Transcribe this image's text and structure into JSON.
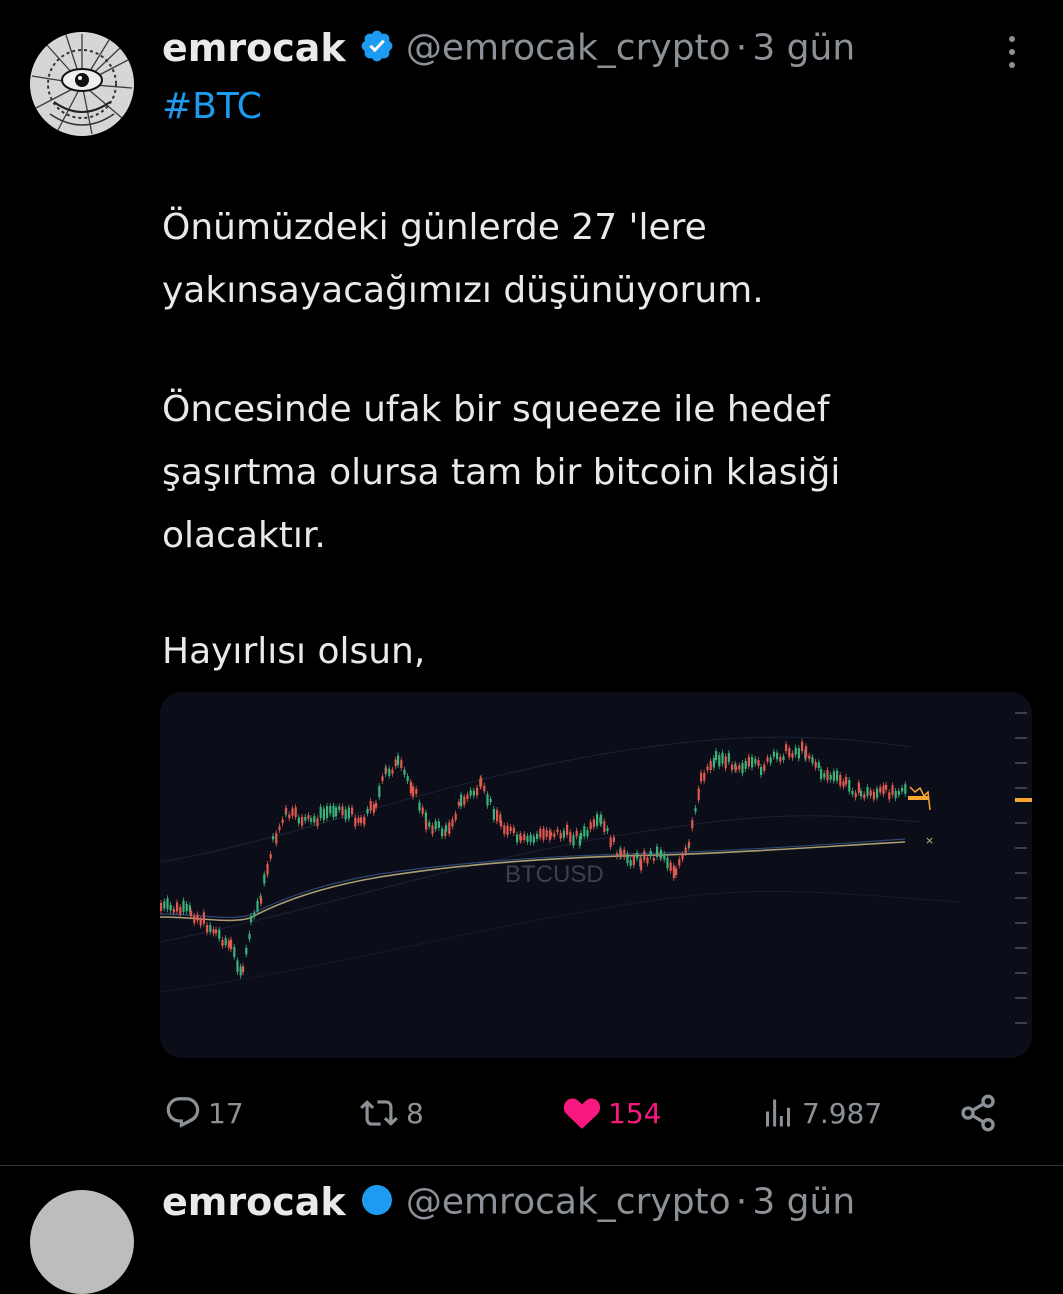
{
  "tweet": {
    "author_name": "emrocak",
    "handle": "@emrocak_crypto",
    "separator": "·",
    "time": "3 gün",
    "hashtag": "#BTC",
    "paragraphs": [
      [
        "Önümüzdeki günlerde 27 'lere",
        "yakınsayacağımızı düşünüyorum."
      ],
      [
        "Öncesinde ufak bir squeeze ile hedef",
        "şaşırtma olursa tam bir bitcoin klasiği",
        "olacaktır."
      ],
      [
        "Hayırlısı olsun,"
      ]
    ],
    "media": {
      "watermark": "BTCUSD"
    }
  },
  "actions": {
    "replies": "17",
    "retweets": "8",
    "likes": "154",
    "views": "7.987",
    "icons": [
      "reply-icon",
      "retweet-icon",
      "heart-icon",
      "views-icon",
      "share-icon"
    ],
    "colors": {
      "muted": "#8b9196",
      "like": "#f91880",
      "link": "#1d9bf0",
      "verified": "#1d9bf0"
    }
  },
  "next_tweet": {
    "author_name": "emrocak",
    "handle": "@emrocak_crypto",
    "separator": "·",
    "time": "3 gün"
  }
}
